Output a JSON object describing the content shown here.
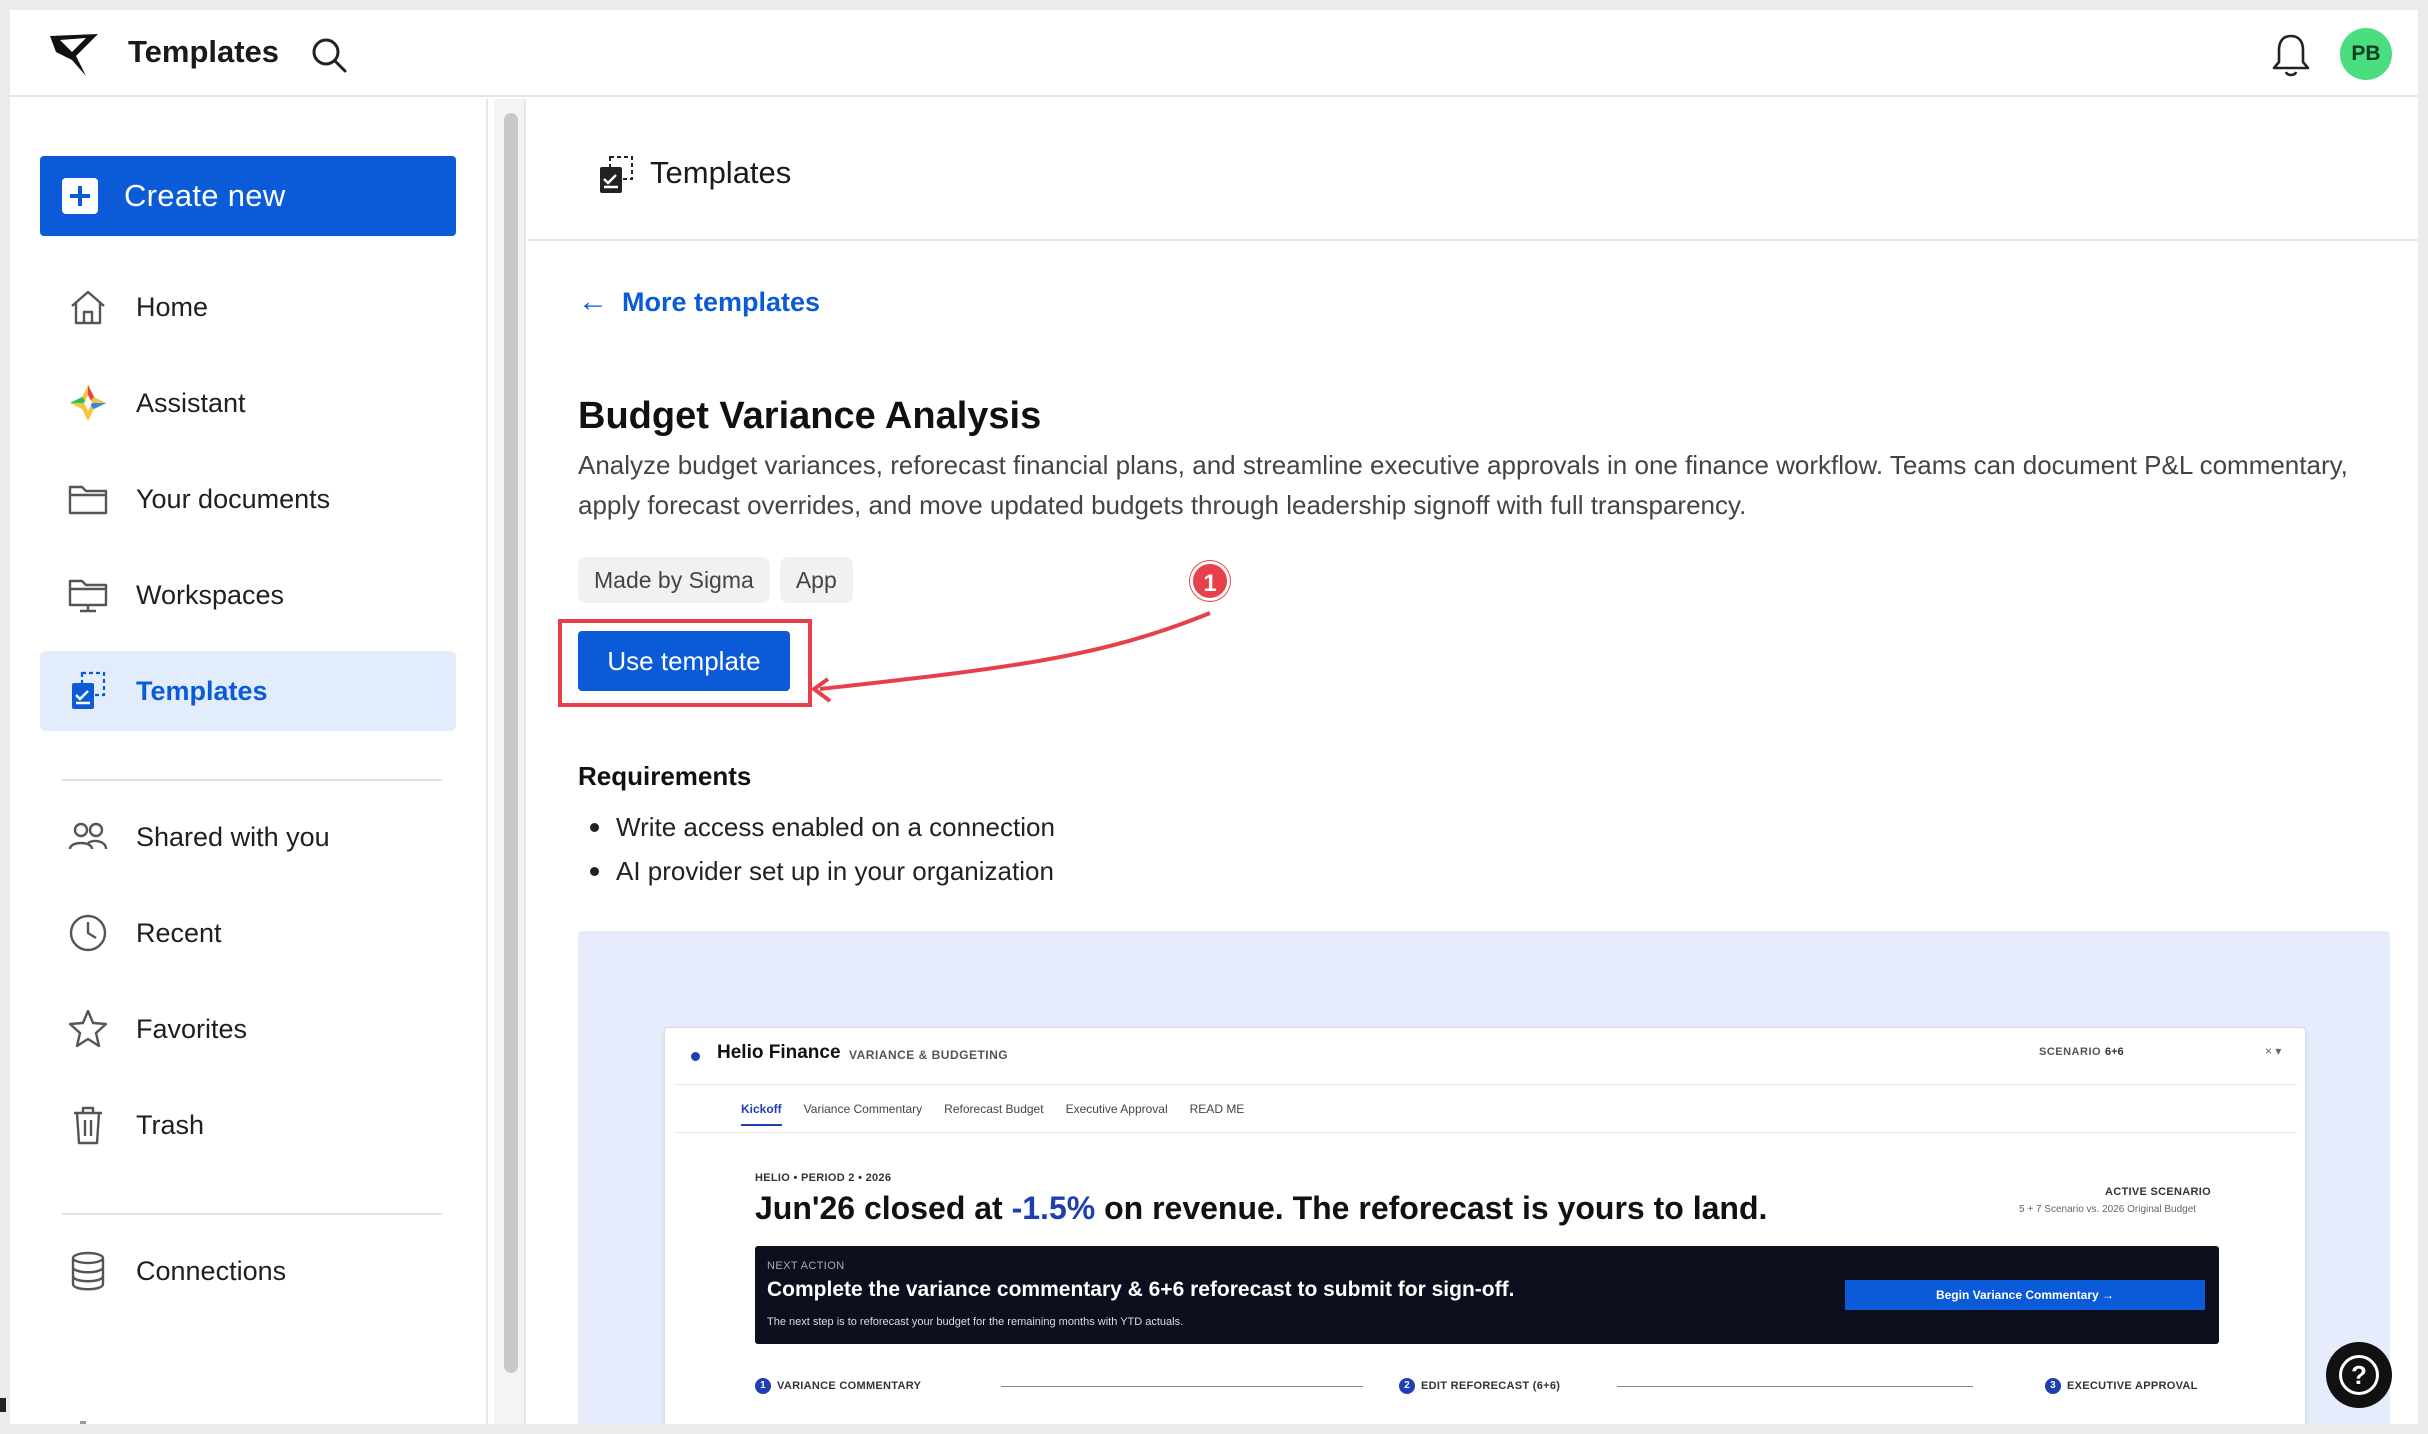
{
  "header": {
    "app_title": "Templates",
    "avatar_initials": "PB"
  },
  "sidebar": {
    "create_label": "Create new",
    "items": [
      {
        "label": "Home",
        "icon": "home-icon"
      },
      {
        "label": "Assistant",
        "icon": "assistant-icon"
      },
      {
        "label": "Your documents",
        "icon": "folder-icon"
      },
      {
        "label": "Workspaces",
        "icon": "workspace-icon"
      },
      {
        "label": "Templates",
        "icon": "templates-icon",
        "active": true
      },
      {
        "label": "Shared with you",
        "icon": "users-icon"
      },
      {
        "label": "Recent",
        "icon": "clock-icon"
      },
      {
        "label": "Favorites",
        "icon": "star-icon"
      },
      {
        "label": "Trash",
        "icon": "trash-icon"
      },
      {
        "label": "Connections",
        "icon": "database-icon"
      }
    ]
  },
  "main": {
    "page_title": "Templates",
    "back_link": "More templates",
    "template": {
      "title": "Budget Variance Analysis",
      "description": "Analyze budget variances, reforecast financial plans, and streamline executive approvals in one finance workflow. Teams can document P&L commentary, apply forecast overrides, and move updated budgets through leadership signoff with full transparency.",
      "tags": [
        "Made by Sigma",
        "App"
      ],
      "use_label": "Use template",
      "annotation_number": "1"
    },
    "requirements": {
      "title": "Requirements",
      "items": [
        "Write access enabled on a connection",
        "AI provider set up in your organization"
      ]
    },
    "preview": {
      "brand": "Helio Finance",
      "brand_sub": "VARIANCE & BUDGETING",
      "scenario_label": "SCENARIO",
      "scenario_value": "6+6",
      "close_glyph": "× ▾",
      "tabs": [
        "Kickoff",
        "Variance Commentary",
        "Reforecast Budget",
        "Executive Approval",
        "READ ME"
      ],
      "period": "HELIO • PERIOD 2 • 2026",
      "headline_pre": "Jun'26 closed at ",
      "headline_value": "-1.5%",
      "headline_post": " on revenue. The reforecast is yours to land.",
      "active_scenario": "ACTIVE SCENARIO",
      "active_scenario_sub": "5 + 7 Scenario vs. 2026 Original Budget",
      "next_action_label": "NEXT ACTION",
      "next_action_title": "Complete the variance commentary & 6+6 reforecast to submit for sign-off.",
      "next_action_sub": "The next step is to reforecast your budget for the remaining months with YTD actuals.",
      "begin_label": "Begin Variance Commentary →",
      "steps": [
        {
          "num": "1",
          "label": "VARIANCE COMMENTARY"
        },
        {
          "num": "2",
          "label": "EDIT REFORECAST (6+6)"
        },
        {
          "num": "3",
          "label": "EXECUTIVE APPROVAL"
        }
      ]
    },
    "help_glyph": "?"
  },
  "colors": {
    "primary": "#0b5bd8",
    "annotation": "#e8404a",
    "avatar": "#4ade80"
  }
}
